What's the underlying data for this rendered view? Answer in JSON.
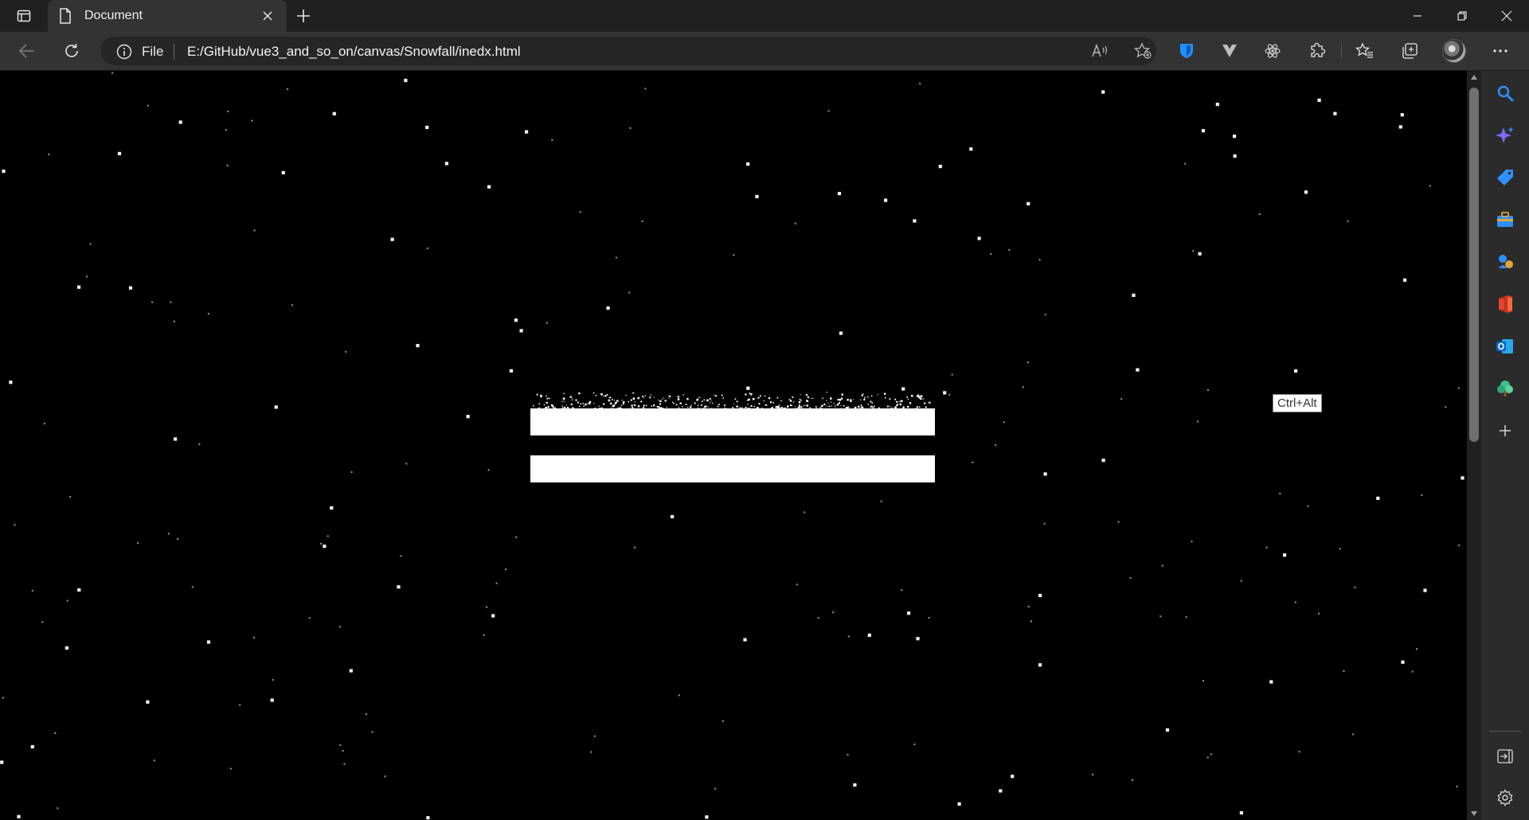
{
  "tab": {
    "title": "Document"
  },
  "address": {
    "scheme_label": "File",
    "url": "E:/GitHub/vue3_and_so_on/canvas/Snowfall/inedx.html"
  },
  "page": {
    "tooltip": "Ctrl+Alt",
    "background": "#000000",
    "snow_color": "#ffffff"
  },
  "browser": {
    "theme": "dark",
    "accent_blue": "#1e90ff"
  },
  "icons": {
    "toolbar": [
      "read-aloud-icon",
      "add-favorite-icon",
      "bitwarden-icon",
      "vue-devtools-icon",
      "react-devtools-icon",
      "extensions-icon",
      "favorites-icon",
      "collections-icon",
      "profile-avatar",
      "more-icon"
    ],
    "sidebar": [
      "search-icon",
      "copilot-icon",
      "shopping-icon",
      "tools-icon",
      "games-icon",
      "office-icon",
      "outlook-icon",
      "tree-icon",
      "add-icon",
      "hide-sidebar-icon",
      "settings-icon"
    ]
  }
}
